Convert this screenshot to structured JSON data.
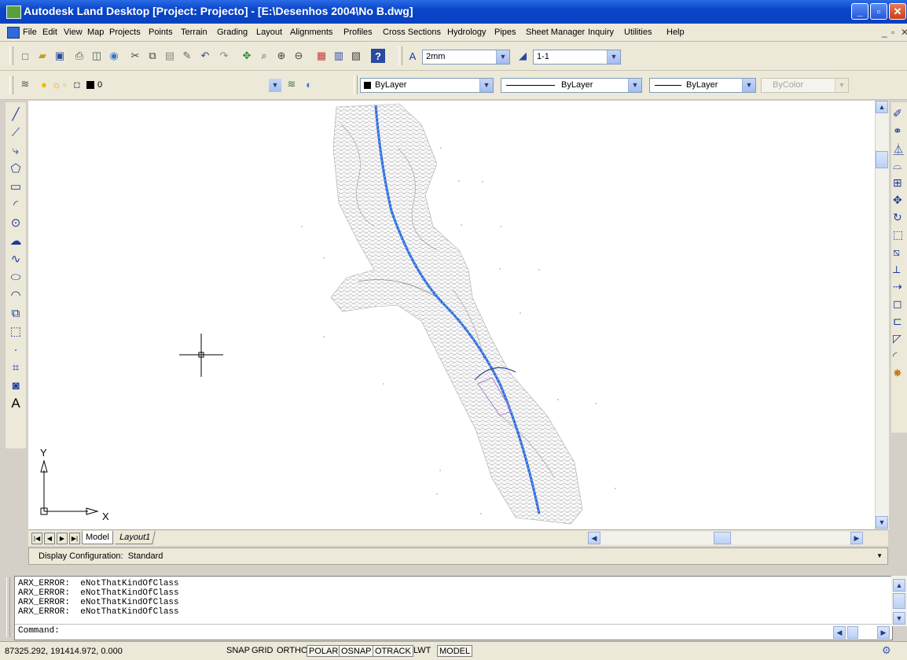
{
  "window": {
    "title": "Autodesk Land Desktop [Project: Projecto] - [E:\\Desenhos 2004\\No B.dwg]",
    "minimize": "_",
    "maximize": "▫",
    "close": "✕"
  },
  "menu": {
    "items": [
      "File",
      "Edit",
      "View",
      "Map",
      "Projects",
      "Points",
      "Terrain",
      "Grading",
      "Layout",
      "Alignments",
      "Profiles",
      "Cross Sections",
      "Hydrology",
      "Pipes",
      "Sheet Manager",
      "Inquiry",
      "Utilities",
      "Help"
    ],
    "doc_min": "_",
    "doc_restore": "▫",
    "doc_close": "✕"
  },
  "standard_toolbar": {
    "text_height": "2mm",
    "scale": "1-1"
  },
  "layers_toolbar": {
    "layer": "0",
    "color": "ByLayer",
    "linetype": "ByLayer",
    "lineweight": "ByLayer",
    "plotstyle": "ByColor"
  },
  "ucs": {
    "y_label": "Y",
    "x_label": "X"
  },
  "tabs": {
    "model": "Model",
    "layout1": "Layout1"
  },
  "display_configuration": "Display Configuration:  Standard",
  "command": {
    "history": [
      "ARX_ERROR:  eNotThatKindOfClass",
      "ARX_ERROR:  eNotThatKindOfClass",
      "ARX_ERROR:  eNotThatKindOfClass",
      "ARX_ERROR:  eNotThatKindOfClass"
    ],
    "prompt": "Command:"
  },
  "status_bar": {
    "coordinates": "87325.292, 191414.972, 0.000",
    "toggles": [
      {
        "label": "SNAP",
        "on": false
      },
      {
        "label": "GRID",
        "on": false
      },
      {
        "label": "ORTHO",
        "on": false
      },
      {
        "label": "POLAR",
        "on": true
      },
      {
        "label": "OSNAP",
        "on": true
      },
      {
        "label": "OTRACK",
        "on": true
      },
      {
        "label": "LWT",
        "on": false
      },
      {
        "label": "MODEL",
        "on": true
      }
    ]
  },
  "colors": {
    "titlebar": "#0a46c8",
    "alignment": "#2a6adc",
    "terrain": "#b4b4b4"
  }
}
